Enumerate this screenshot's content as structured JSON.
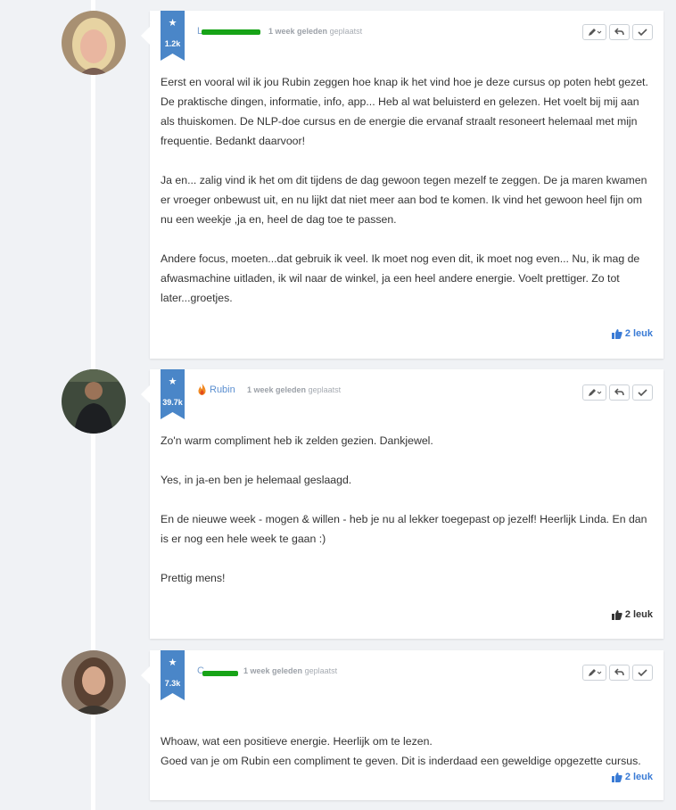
{
  "comments": [
    {
      "author": "",
      "author_redacted": true,
      "rank": "1.2k",
      "time": "1 week geleden",
      "posted": "geplaatst",
      "paragraphs": [
        "Eerst en vooral wil ik jou Rubin zeggen hoe knap ik het vind hoe je deze cursus op poten hebt gezet. De praktische dingen, informatie, info, app... Heb al wat beluisterd en gelezen. Het voelt bij mij aan als thuiskomen. De NLP-doe cursus en de energie die ervanaf straalt resoneert helemaal met mijn frequentie. Bedankt daarvoor!",
        "Ja en... zalig vind ik het om dit tijdens de dag gewoon tegen mezelf te zeggen. De ja maren kwamen er vroeger onbewust uit, en nu lijkt dat niet meer aan bod te komen. Ik vind het gewoon heel fijn om nu een weekje ,ja en, heel de dag toe te passen.",
        "Andere focus, moeten...dat gebruik ik veel. Ik moet nog even dit, ik moet nog even... Nu, ik mag de afwasmachine uitladen, ik wil naar de winkel, ja een heel andere energie. Voelt prettiger. Zo tot later...groetjes."
      ],
      "likes": "2 leuk"
    },
    {
      "author": "Rubin",
      "author_redacted": false,
      "rank": "39.7k",
      "time": "1 week geleden",
      "posted": "geplaatst",
      "paragraphs": [
        "Zo'n warm compliment heb ik zelden gezien. Dankjewel.",
        "Yes, in ja-en ben je helemaal geslaagd.",
        "En de nieuwe week - mogen & willen - heb je nu al lekker toegepast op jezelf! Heerlijk Linda. En dan is er nog een hele week te gaan :)",
        "Prettig mens!"
      ],
      "likes": "2 leuk"
    },
    {
      "author": "",
      "author_redacted": true,
      "rank": "7.3k",
      "time": "1 week geleden",
      "posted": "geplaatst",
      "paragraphs": [
        "Whoaw, wat een positieve energie. Heerlijk om te lezen.\nGoed van je om Rubin een compliment te geven. Dit is inderdaad een geweldige opgezette cursus."
      ],
      "likes": "2 leuk"
    }
  ],
  "icons": {
    "rank": "star-icon",
    "edit": "pencil-icon",
    "reply": "reply-icon",
    "accept": "check-icon",
    "like": "thumbs-up-icon",
    "author_badge": "fire-icon"
  },
  "colors": {
    "rank_badge": "#4a86c8",
    "link": "#3a7bd5",
    "background": "#f0f2f5",
    "redaction": "#17a317"
  }
}
